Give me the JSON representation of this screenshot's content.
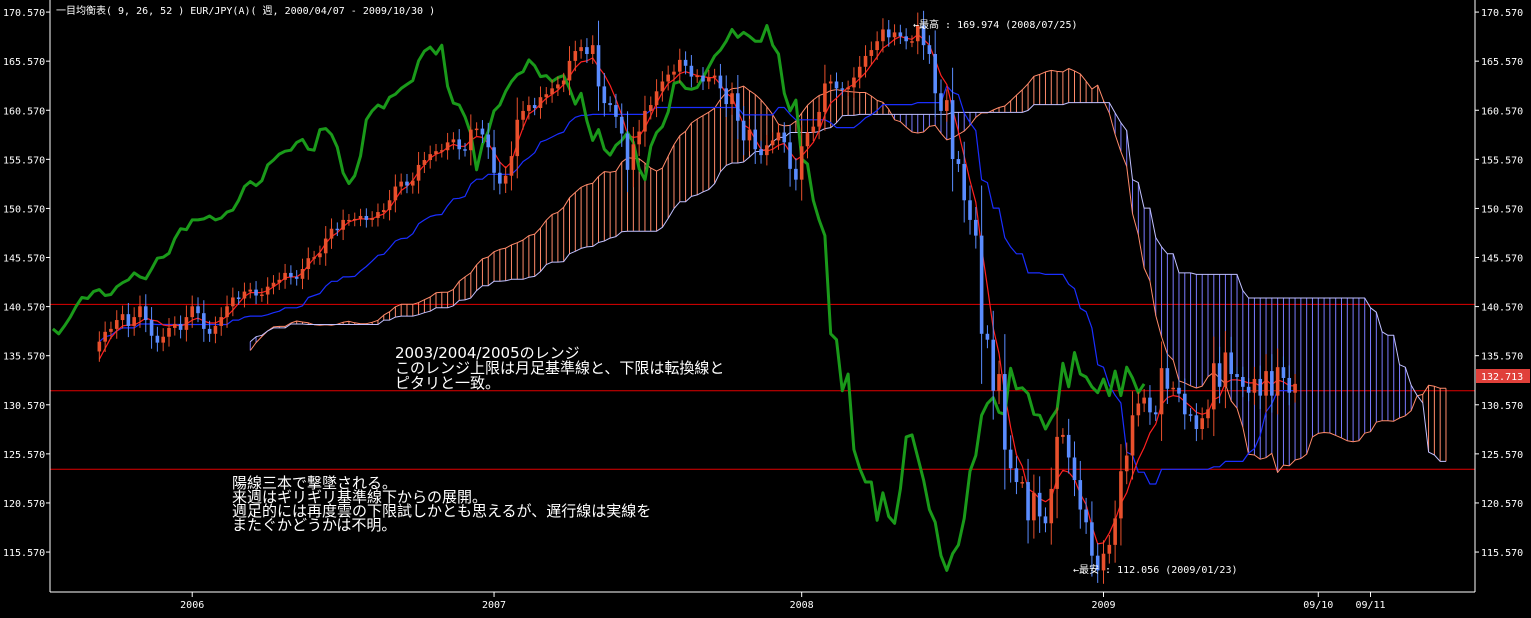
{
  "header": {
    "title": "一目均衡表( 9, 26, 52 )   EUR/JPY(A)( 週, 2000/04/07 - 2009/10/30 )"
  },
  "price_marker": {
    "value": "132.713",
    "color": "#e0403a"
  },
  "colors": {
    "background": "#000000",
    "axis": "#ffffff",
    "up_candle": "#e8502c",
    "down_candle": "#5a8cff",
    "tenkan": "#ff2020",
    "kijun": "#1a2eff",
    "chikou": "#1a9a1a",
    "cloud_up": "#ff8a6a",
    "cloud_down": "#7a7aff",
    "hline": "#e00000"
  },
  "chart_data": {
    "type": "candlestick-ichimoku",
    "y_ticks": [
      "170.570",
      "165.570",
      "160.570",
      "155.570",
      "150.570",
      "145.570",
      "140.570",
      "135.570",
      "130.570",
      "125.570",
      "120.570",
      "115.570"
    ],
    "ylim": [
      111.5,
      171.8
    ],
    "x_labels": [
      {
        "label": "2006",
        "t": 16
      },
      {
        "label": "2007",
        "t": 68
      },
      {
        "label": "2008",
        "t": 121
      },
      {
        "label": "2009",
        "t": 173
      },
      {
        "label": "09/10",
        "t": 210
      },
      {
        "label": "09/11",
        "t": 219
      }
    ],
    "xlim": [
      -8.5,
      237
    ],
    "horizontal_lines": [
      140.8,
      132.0,
      124.0
    ],
    "max_label": "←最高 : 169.974 (2008/07/25)",
    "min_label": "←最安 : 112.056 (2009/01/23)",
    "closes": [
      137.0,
      138.0,
      138.3,
      139.2,
      139.8,
      138.6,
      139.5,
      140.6,
      139.2,
      137.6,
      136.9,
      137.5,
      138.4,
      138.8,
      138.2,
      139.5,
      140.6,
      139.9,
      138.3,
      137.8,
      138.6,
      139.5,
      140.6,
      141.5,
      141.4,
      142.1,
      142.3,
      141.7,
      141.8,
      142.6,
      143.0,
      143.3,
      144.0,
      143.6,
      143.4,
      144.4,
      145.5,
      145.6,
      146.0,
      147.5,
      148.5,
      148.4,
      149.4,
      149.4,
      149.5,
      149.8,
      149.4,
      149.6,
      150.2,
      150.4,
      151.4,
      152.8,
      153.3,
      152.9,
      153.4,
      155.0,
      155.5,
      156.1,
      156.4,
      156.5,
      157.3,
      157.6,
      156.6,
      156.5,
      158.6,
      158.7,
      158.1,
      156.8,
      154.2,
      153.1,
      153.9,
      155.9,
      159.6,
      160.5,
      161.1,
      160.8,
      161.9,
      162.2,
      162.8,
      163.2,
      163.6,
      165.6,
      166.6,
      167.0,
      166.3,
      167.2,
      163.0,
      161.3,
      161.1,
      159.9,
      158.2,
      154.5,
      157.1,
      158.4,
      160.5,
      161.1,
      162.5,
      163.5,
      164.2,
      164.5,
      165.7,
      165.1,
      164.0,
      164.1,
      163.5,
      163.9,
      164.1,
      162.8,
      161.2,
      162.3,
      159.5,
      157.5,
      158.6,
      156.6,
      156.0,
      157.0,
      157.5,
      158.3,
      157.3,
      154.6,
      153.5,
      156.9,
      158.3,
      158.9,
      160.4,
      163.3,
      163.5,
      162.8,
      162.7,
      162.9,
      163.9,
      165.0,
      166.1,
      166.7,
      167.6,
      168.8,
      168.0,
      168.5,
      168.1,
      167.6,
      167.6,
      169.2,
      167.2,
      166.3,
      162.3,
      160.5,
      161.6,
      155.6,
      155.1,
      151.4,
      149.4,
      147.8,
      137.8,
      137.2,
      132.0,
      133.7,
      126.0,
      124.1,
      122.7,
      122.7,
      118.8,
      121.6,
      119.2,
      118.5,
      122.0,
      127.3,
      127.5,
      125.2,
      122.9,
      119.9,
      118.6,
      115.2,
      113.7,
      115.4,
      116.3,
      119.0,
      123.8,
      125.4,
      129.5,
      130.7,
      131.3,
      129.8,
      129.6,
      134.3,
      132.2,
      132.3,
      131.7,
      129.6,
      129.5,
      128.1,
      129.2,
      130.1,
      134.8,
      132.4,
      135.9,
      133.7,
      133.4,
      132.4,
      131.8,
      133.2,
      131.5,
      134.0,
      131.5,
      134.4,
      133.3,
      131.8,
      132.7
    ],
    "tenkan": [
      135.2,
      136.3,
      137.4,
      138.1,
      138.6,
      138.7,
      138.7,
      139.0,
      139.4,
      139.2,
      139.1,
      138.7,
      138.6,
      138.7,
      138.6,
      138.8,
      139.2,
      139.4,
      139.1,
      138.9,
      138.9,
      139.2,
      139.6,
      140.2,
      140.9,
      141.6,
      142.0,
      142.0,
      142.0,
      142.2,
      142.6,
      143.0,
      143.5,
      143.6,
      143.6,
      144.0,
      144.8,
      145.5,
      146.1,
      147.0,
      147.7,
      148.1,
      148.7,
      149.2,
      149.4,
      149.5,
      149.5,
      149.5,
      149.8,
      150.0,
      150.6,
      151.5,
      152.4,
      152.8,
      153.4,
      154.3,
      155.0,
      155.7,
      156.1,
      156.3,
      156.8,
      157.1,
      156.9,
      156.9,
      157.5,
      157.9,
      157.8,
      157.2,
      156.3,
      155.3,
      154.7,
      155.3,
      157.2,
      158.8,
      160.2,
      160.6,
      161.2,
      161.8,
      162.2,
      162.6,
      163.2,
      164.0,
      164.9,
      165.5,
      165.6,
      165.9,
      165.0,
      164.2,
      163.1,
      161.7,
      160.1,
      158.1,
      157.8,
      157.9,
      158.8,
      160.0,
      161.3,
      162.4,
      163.3,
      163.7,
      164.3,
      164.5,
      164.3,
      164.1,
      164.0,
      163.9,
      163.9,
      163.2,
      162.3,
      161.9,
      160.5,
      159.1,
      158.7,
      157.6,
      156.6,
      156.4,
      156.6,
      157.0,
      157.2,
      156.3,
      155.5,
      155.9,
      156.6,
      157.3,
      158.5,
      160.1,
      161.3,
      161.8,
      162.4,
      162.9,
      163.2,
      163.8,
      164.4,
      165.2,
      166.0,
      166.9,
      167.3,
      167.8,
      168.1,
      167.9,
      167.8,
      168.3,
      167.8,
      167.2,
      165.7,
      164.1,
      163.2,
      160.7,
      158.4,
      155.9,
      153.4,
      151.2,
      146.6,
      142.6,
      138.4,
      135.8,
      131.7,
      128.3,
      125.5,
      124.3,
      122.0,
      121.6,
      121.0,
      120.7,
      121.1,
      123.0,
      123.9,
      123.7,
      123.0,
      121.5,
      120.4,
      118.2,
      116.4,
      116.5,
      117.5,
      118.8,
      120.5,
      121.6,
      123.4,
      125.0,
      126.2,
      127.7,
      128.6,
      130.6,
      131.3,
      131.5,
      131.4,
      130.9,
      130.4,
      129.8,
      129.6,
      129.8,
      131.1,
      131.4,
      132.8,
      133.1,
      133.1,
      133.0,
      132.8,
      132.8,
      132.5,
      133.1,
      132.6,
      133.1,
      132.9,
      132.5,
      132.5
    ]
  }
}
